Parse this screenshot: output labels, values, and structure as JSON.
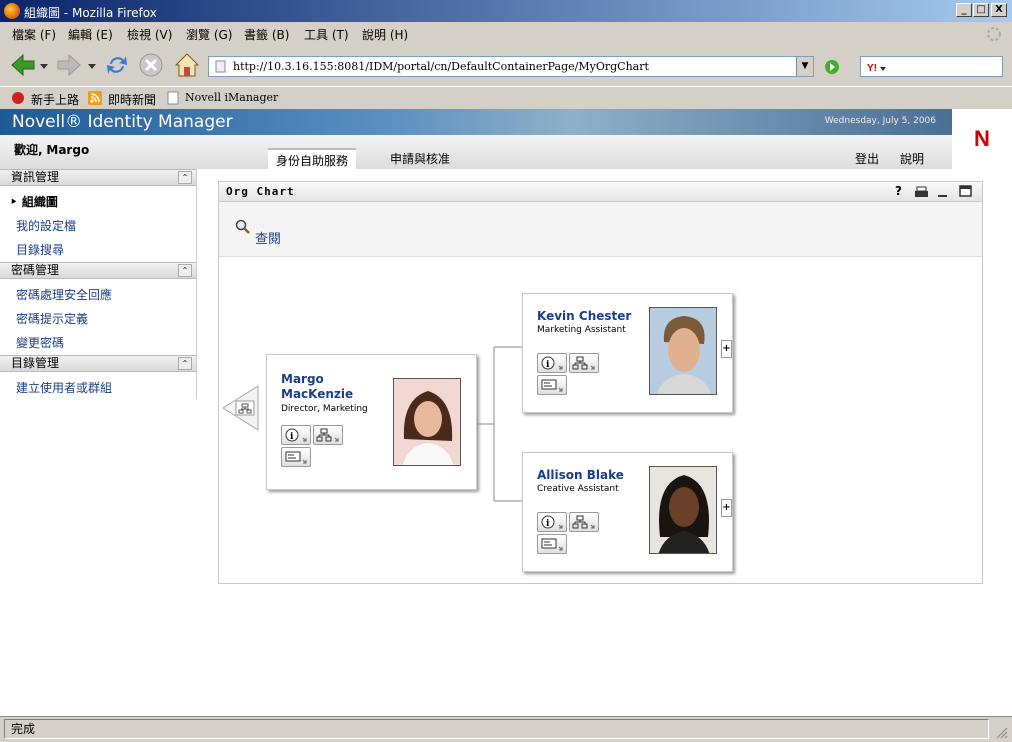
{
  "window": {
    "title": "組織圖 - Mozilla Firefox",
    "min": "_",
    "max": "□",
    "close": "X"
  },
  "menu": [
    "檔案 (F)",
    "編輯 (E)",
    "檢視 (V)",
    "瀏覽 (G)",
    "書籤 (B)",
    "工具 (T)",
    "說明 (H)"
  ],
  "nav": {
    "url": "http://10.3.16.155:8081/IDM/portal/cn/DefaultContainerPage/MyOrgChart",
    "search_placeholder": ""
  },
  "bookmarks": [
    "新手上路",
    "即時新聞",
    "Novell iManager"
  ],
  "header": {
    "brand": "Novell® Identity Manager",
    "date": "Wednesday, July 5, 2006",
    "welcome_label": "歡迎,",
    "user": "Margo",
    "tabs": [
      "身份自助服務",
      "申請與核准"
    ],
    "logout": "登出",
    "help": "說明",
    "logo": "N"
  },
  "sidebar": {
    "sections": [
      {
        "title": "資訊管理",
        "items": [
          "組織圖",
          "我的設定檔",
          "目錄搜尋"
        ]
      },
      {
        "title": "密碼管理",
        "items": [
          "密碼處理安全回應",
          "密碼提示定義",
          "變更密碼"
        ]
      },
      {
        "title": "目錄管理",
        "items": [
          "建立使用者或群組"
        ]
      }
    ]
  },
  "portlet": {
    "title": "Org Chart",
    "help_icon": "?",
    "lookup": "查閱",
    "manager": {
      "name1": "Margo",
      "name2": "MacKenzie",
      "title": "Director, Marketing"
    },
    "reports": [
      {
        "name": "Kevin Chester",
        "title": "Marketing Assistant",
        "expand": "+"
      },
      {
        "name": "Allison Blake",
        "title": "Creative Assistant",
        "expand": "+"
      }
    ]
  },
  "status": "完成",
  "colors": {
    "link": "#1b3f87",
    "brand_red": "#d40000",
    "banner": "#1e5a94"
  }
}
